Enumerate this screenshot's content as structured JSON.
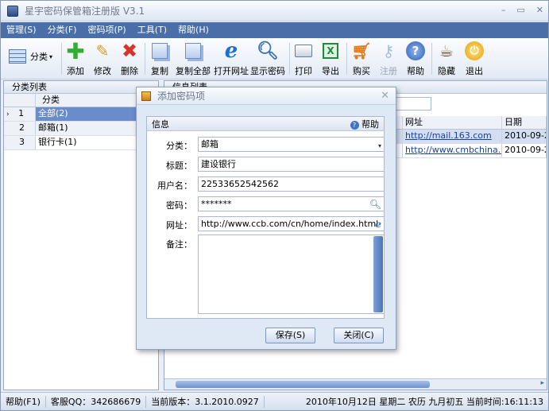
{
  "window": {
    "title": "星宇密码保管箱注册版",
    "version": "V3.1"
  },
  "menu": [
    "管理(S)",
    "分类(F)",
    "密码项(P)",
    "工具(T)",
    "帮助(H)"
  ],
  "toolbar": {
    "category_label": "分类",
    "buttons": [
      {
        "label": "添加",
        "icon": "plus-icon",
        "enabled": true
      },
      {
        "label": "修改",
        "icon": "pencil-icon",
        "enabled": true
      },
      {
        "label": "删除",
        "icon": "delete-x-icon",
        "enabled": true
      },
      {
        "label": "复制",
        "icon": "copy-icon",
        "enabled": true
      },
      {
        "label": "复制全部",
        "icon": "copy-all-icon",
        "enabled": true
      },
      {
        "label": "打开网址",
        "icon": "ie-icon",
        "enabled": true
      },
      {
        "label": "显示密码",
        "icon": "magnifier-icon",
        "enabled": true
      },
      {
        "label": "打印",
        "icon": "printer-icon",
        "enabled": true
      },
      {
        "label": "导出",
        "icon": "excel-icon",
        "enabled": true
      },
      {
        "label": "购买",
        "icon": "cart-icon",
        "enabled": true
      },
      {
        "label": "注册",
        "icon": "key-icon",
        "enabled": false
      },
      {
        "label": "帮助",
        "icon": "help-icon",
        "enabled": true
      },
      {
        "label": "隐藏",
        "icon": "coffee-icon",
        "enabled": true
      },
      {
        "label": "退出",
        "icon": "power-icon",
        "enabled": true
      }
    ]
  },
  "category_panel": {
    "title": "分类列表",
    "column": "分类",
    "rows": [
      {
        "num": "1",
        "name": "全部(2)",
        "selected": true
      },
      {
        "num": "2",
        "name": "邮箱(1)",
        "selected": false
      },
      {
        "num": "3",
        "name": "银行卡(1)",
        "selected": false
      }
    ]
  },
  "info_panel": {
    "title": "信息列表",
    "columns": [
      "网址",
      "日期"
    ],
    "rows": [
      {
        "url": "http://mail.163.com",
        "date": "2010-09-2"
      },
      {
        "url": "http://www.cmbchina....",
        "date": "2010-09-2"
      }
    ]
  },
  "dialog": {
    "title": "添加密码项",
    "section": "信息",
    "help_label": "帮助",
    "fields": {
      "category_label": "分类：",
      "category_value": "邮箱",
      "title_label": "标题：",
      "title_value": "建设银行",
      "username_label": "用户名：",
      "username_value": "22533652542562",
      "password_label": "密码：",
      "password_value": "*******",
      "url_label": "网址：",
      "url_value": "http://www.ccb.com/cn/home/index.html",
      "notes_label": "备注：",
      "notes_value": ""
    },
    "save_label": "保存(S)",
    "close_label": "关闭(C)"
  },
  "status": {
    "help": "帮助(F1)",
    "qq": "客服QQ：342686679",
    "version": "当前版本：3.1.2010.0927",
    "datetime": "2010年10月12日 星期二 农历 九月初五 当前时间:16:11:13"
  },
  "colors": {
    "menubar": "#4a6ea7",
    "selection": "#6a8ccb",
    "link": "#1a3fa8"
  }
}
